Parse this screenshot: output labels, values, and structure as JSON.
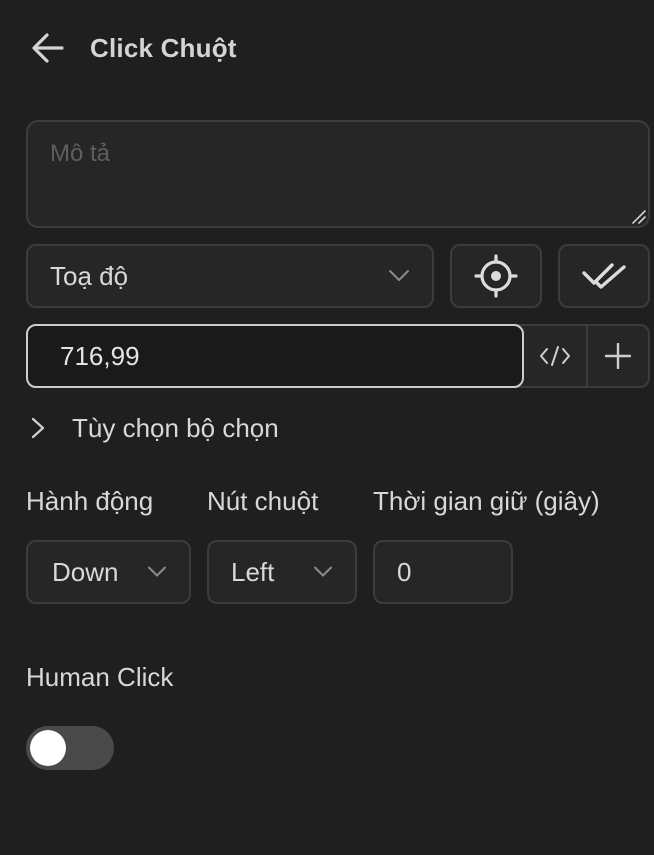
{
  "header": {
    "title": "Click Chuột",
    "back_icon": "arrow-left-icon"
  },
  "description": {
    "placeholder": "Mô tả",
    "value": ""
  },
  "locator": {
    "type_value": "Toạ độ",
    "target_icon": "crosshair-target-icon",
    "check_icon": "double-check-icon",
    "coordinates": "716,99",
    "code_icon": "code-icon",
    "add_icon": "plus-icon"
  },
  "selector_options": {
    "label": "Tùy chọn bộ chọn",
    "expanded": false
  },
  "action": {
    "label": "Hành động",
    "value": "Down"
  },
  "mouse_button": {
    "label": "Nút chuột",
    "value": "Left"
  },
  "hold_time": {
    "label": "Thời gian giữ (giây)",
    "value": "0"
  },
  "human_click": {
    "label": "Human Click",
    "enabled": false
  },
  "colors": {
    "background": "#1f1f1f",
    "border": "#3c3c3c",
    "focus_border": "#c9ced6",
    "text": "#d8d8d8",
    "toggle_off": "#4a4a4a"
  }
}
